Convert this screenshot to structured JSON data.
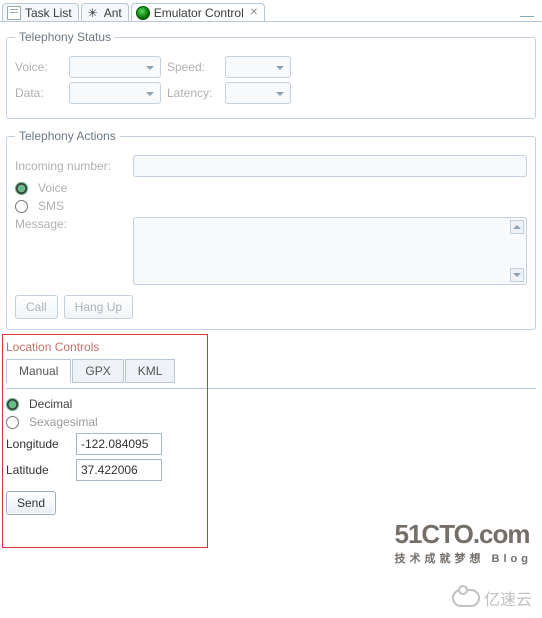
{
  "tabs": [
    {
      "label": "Task List",
      "icon": "task-list-icon"
    },
    {
      "label": "Ant",
      "icon": "ant-icon"
    },
    {
      "label": "Emulator Control",
      "icon": "emulator-icon",
      "active": true
    }
  ],
  "telephony_status": {
    "title": "Telephony Status",
    "voice_label": "Voice:",
    "speed_label": "Speed:",
    "data_label": "Data:",
    "latency_label": "Latency:"
  },
  "telephony_actions": {
    "title": "Telephony Actions",
    "incoming_label": "Incoming number:",
    "voice_radio": "Voice",
    "sms_radio": "SMS",
    "message_label": "Message:",
    "call_btn": "Call",
    "hangup_btn": "Hang Up"
  },
  "location": {
    "title": "Location Controls",
    "tabs": {
      "manual": "Manual",
      "gpx": "GPX",
      "kml": "KML"
    },
    "decimal_radio": "Decimal",
    "sexagesimal_radio": "Sexagesimal",
    "longitude_label": "Longitude",
    "latitude_label": "Latitude",
    "longitude_value": "-122.084095",
    "latitude_value": "37.422006",
    "send_btn": "Send"
  },
  "watermark": {
    "line1": "51CTO.com",
    "line2": "技术成就梦想  Blog",
    "brand2": "亿速云"
  }
}
